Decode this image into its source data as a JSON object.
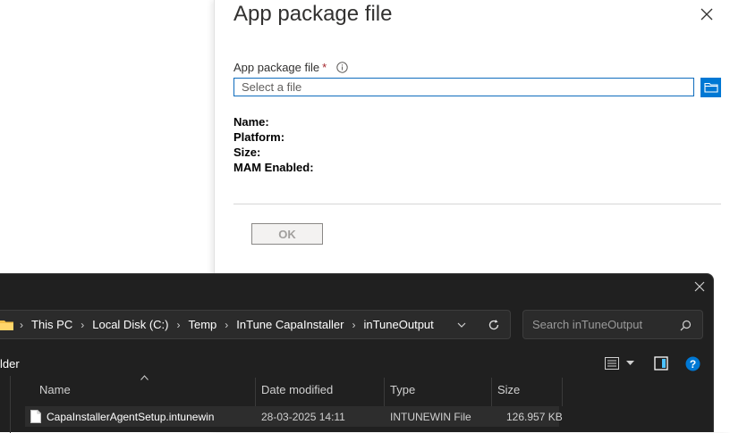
{
  "panel": {
    "title": "App package file",
    "field_label": "App package file",
    "required_mark": "*",
    "file_placeholder": "Select a file",
    "props": [
      "Name:",
      "Platform:",
      "Size:",
      "MAM Enabled:"
    ],
    "ok_label": "OK"
  },
  "explorer": {
    "breadcrumbs": [
      "This PC",
      "Local Disk (C:)",
      "Temp",
      "InTune CapaInstaller",
      "inTuneOutput"
    ],
    "search_placeholder": "Search inTuneOutput",
    "new_folder_label": "lder",
    "columns": [
      "Name",
      "Date modified",
      "Type",
      "Size"
    ],
    "files": [
      {
        "name": "CapaInstallerAgentSetup.intunewin",
        "date": "28-03-2025 14:11",
        "type": "INTUNEWIN File",
        "size": "126.957 KB"
      }
    ]
  },
  "colors": {
    "accent": "#0078d4",
    "dark_bg": "#202020",
    "required": "#a4262c"
  },
  "icons": [
    "close-icon",
    "info-icon",
    "folder-icon",
    "chevron-down-icon",
    "refresh-icon",
    "search-icon",
    "view-icon",
    "details-pane-icon",
    "help-icon",
    "file-icon"
  ]
}
